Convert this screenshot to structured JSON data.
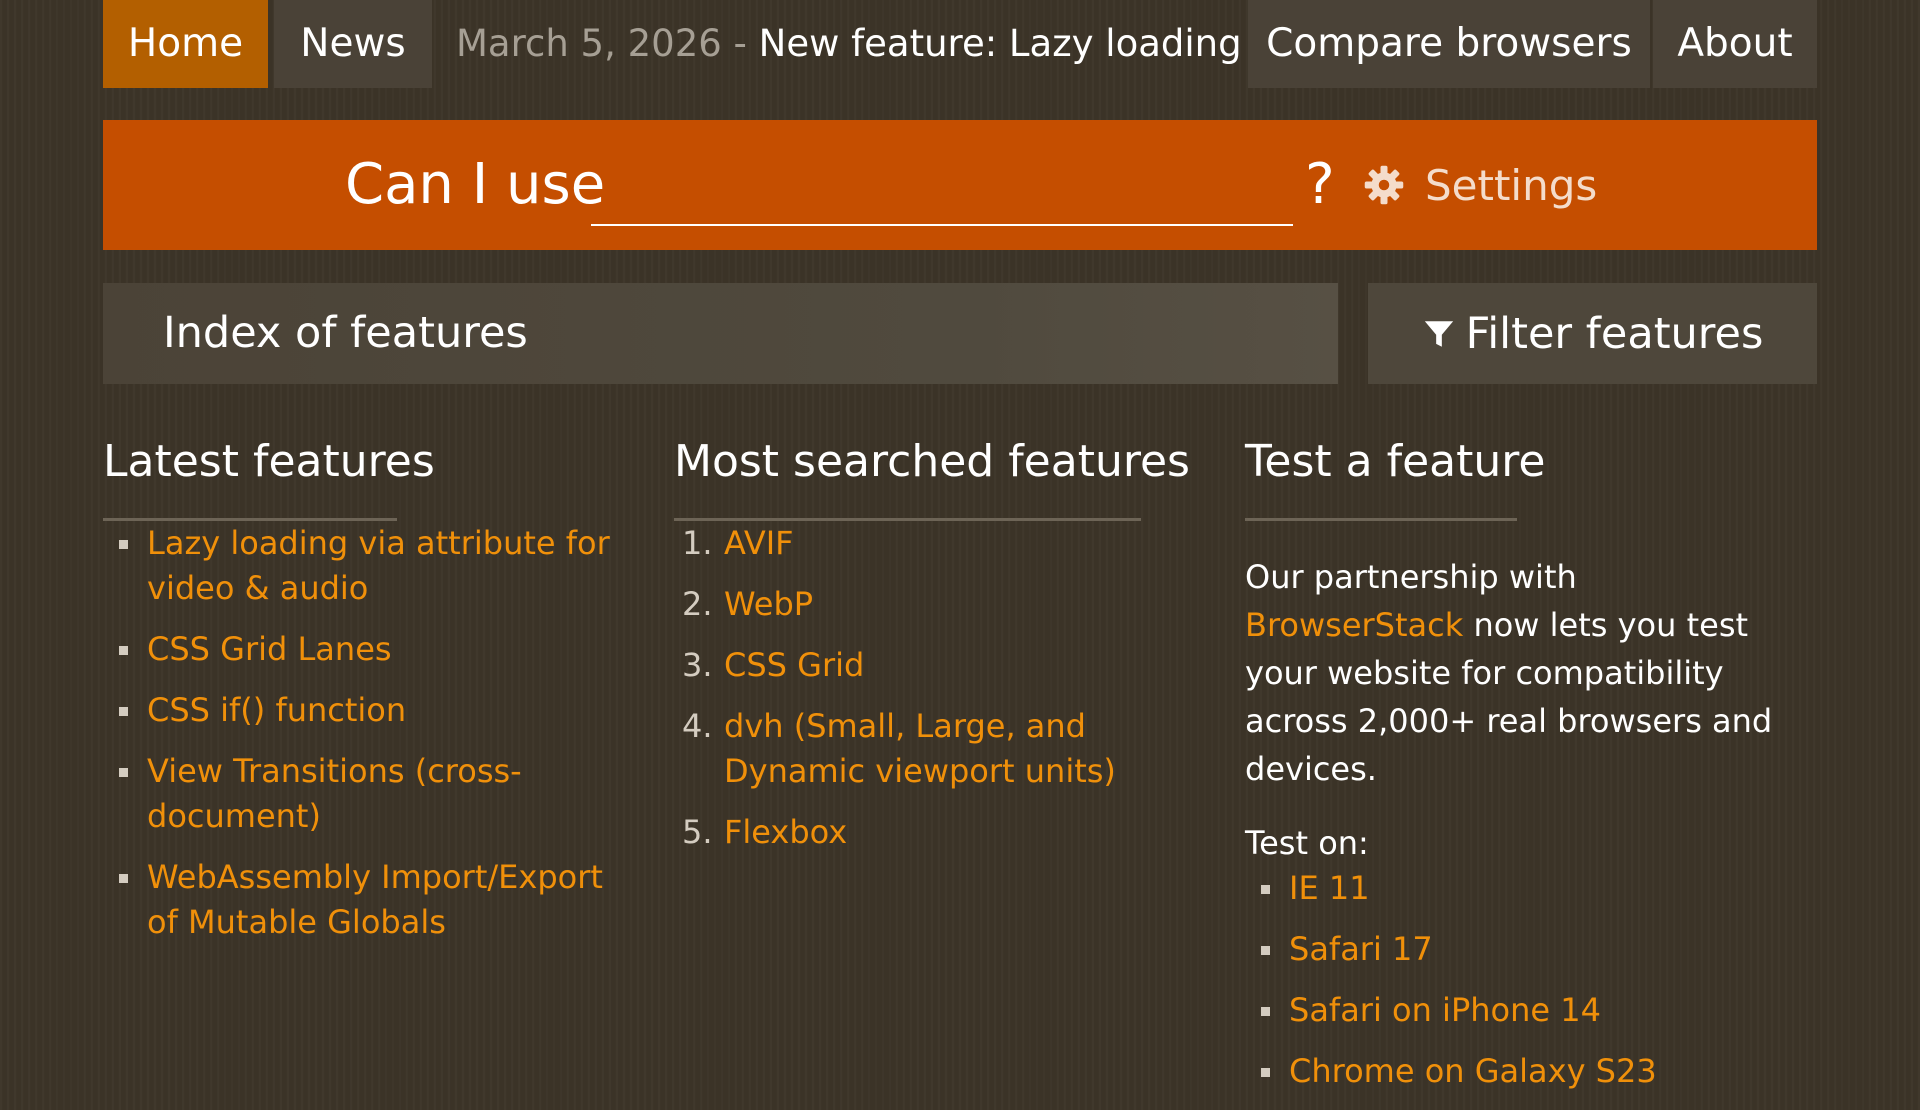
{
  "nav": {
    "home": "Home",
    "news": "News",
    "latest_date": "March 5, 2026",
    "latest_sep": " - ",
    "latest_title": "New feature: Lazy loading via ...",
    "compare": "Compare browsers",
    "about": "About"
  },
  "search": {
    "label": "Can I use",
    "value": "",
    "question": "?",
    "settings": "Settings"
  },
  "index": {
    "title": "Index of features",
    "filter": "Filter features"
  },
  "latest": {
    "heading": "Latest features",
    "items": [
      "Lazy loading via attribute for video & audio",
      "CSS Grid Lanes",
      "CSS if() function",
      "View Transitions (cross-document)",
      "WebAssembly Import/Export of Mutable Globals"
    ]
  },
  "searched": {
    "heading": "Most searched features",
    "items": [
      {
        "num": "1.",
        "label": "AVIF"
      },
      {
        "num": "2.",
        "label": "WebP"
      },
      {
        "num": "3.",
        "label": "CSS Grid"
      },
      {
        "num": "4.",
        "label": "dvh (Small, Large, and Dynamic viewport units)"
      },
      {
        "num": "5.",
        "label": "Flexbox"
      }
    ]
  },
  "test": {
    "heading": "Test a feature",
    "text_before": "Our partnership with ",
    "link": "BrowserStack",
    "text_after": " now lets you test your website for compatibility across 2,000+ real browsers and devices.",
    "test_on": "Test on:",
    "items": [
      "IE 11",
      "Safari 17",
      "Safari on iPhone 14",
      "Chrome on Galaxy S23"
    ]
  },
  "colors": {
    "background": "#3c3428",
    "accent_orange": "#c54e00",
    "home_tab": "#b35f00",
    "link": "#f0900a",
    "nav_tab": "#4a4237"
  }
}
